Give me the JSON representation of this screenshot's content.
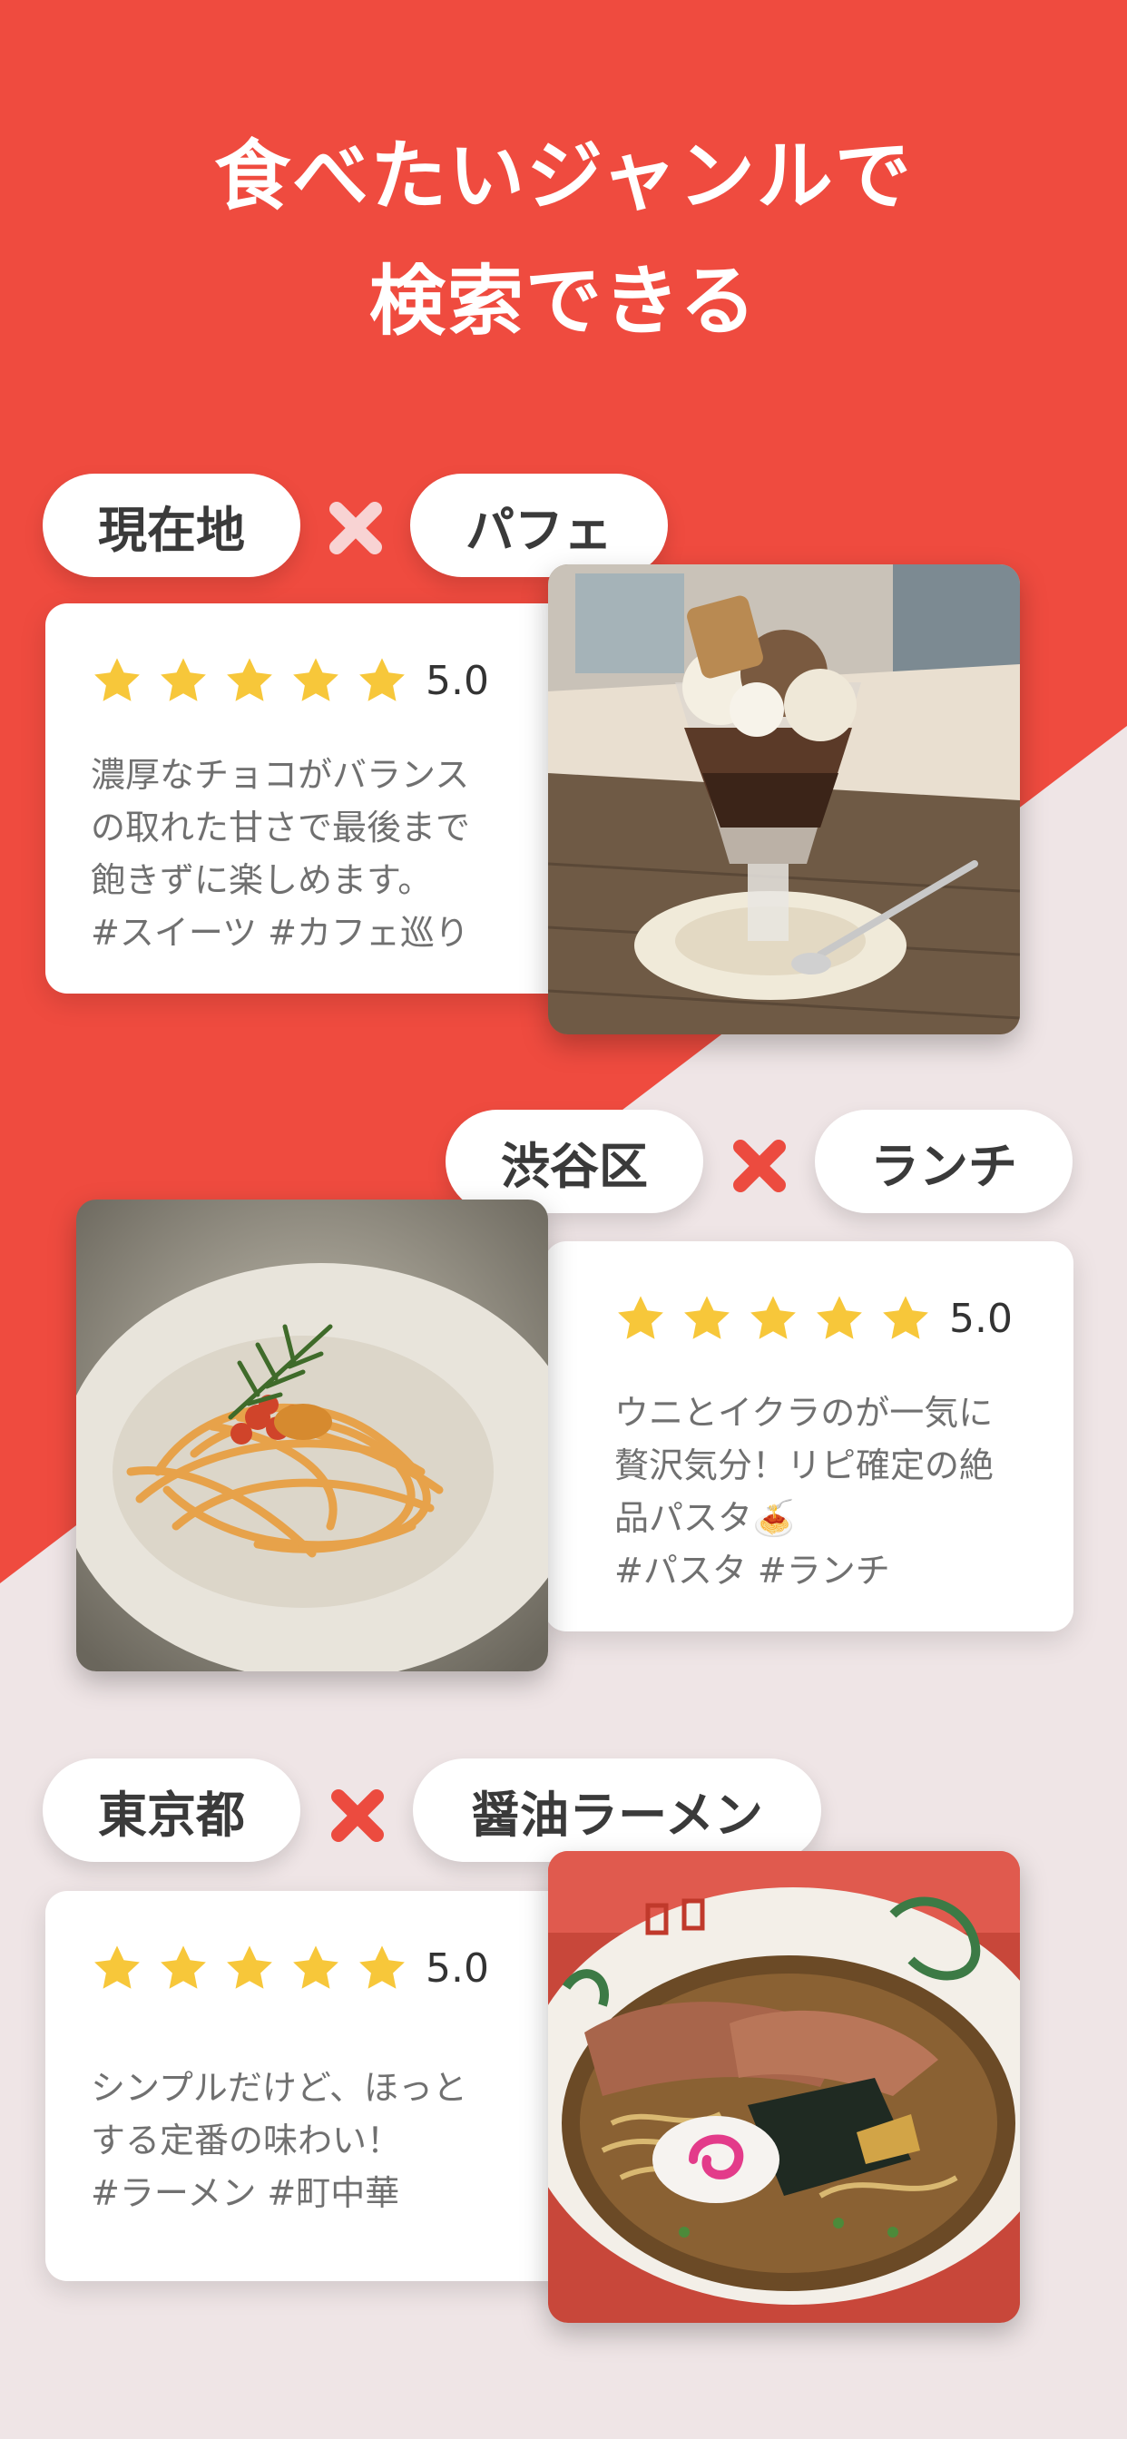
{
  "headline": {
    "line1": "食べたいジャンルで",
    "line2": "検索できる"
  },
  "colors": {
    "accent": "#ef4b3f",
    "background": "#efe5e6",
    "star": "#f7c73a",
    "cross_light": "#f8d3d3",
    "cross_red": "#ec4b3f"
  },
  "examples": [
    {
      "location_tag": "現在地",
      "genre_tag": "パフェ",
      "rating": "5.0",
      "stars": 5,
      "description": "濃厚なチョコがバランス\nの取れた甘さで最後まで\n飽きずに楽しめます。\n#スイーツ #カフェ巡り",
      "photo": "parfait-photo"
    },
    {
      "location_tag": "渋谷区",
      "genre_tag": "ランチ",
      "rating": "5.0",
      "stars": 5,
      "description": "ウニとイクラのが一気に\n贅沢気分！リピ確定の絶\n品パスタ🍝\n#パスタ #ランチ",
      "photo": "pasta-photo"
    },
    {
      "location_tag": "東京都",
      "genre_tag": "醤油ラーメン",
      "rating": "5.0",
      "stars": 5,
      "description": "シンプルだけど、ほっと\nする定番の味わい！\n#ラーメン #町中華",
      "photo": "ramen-photo"
    }
  ]
}
